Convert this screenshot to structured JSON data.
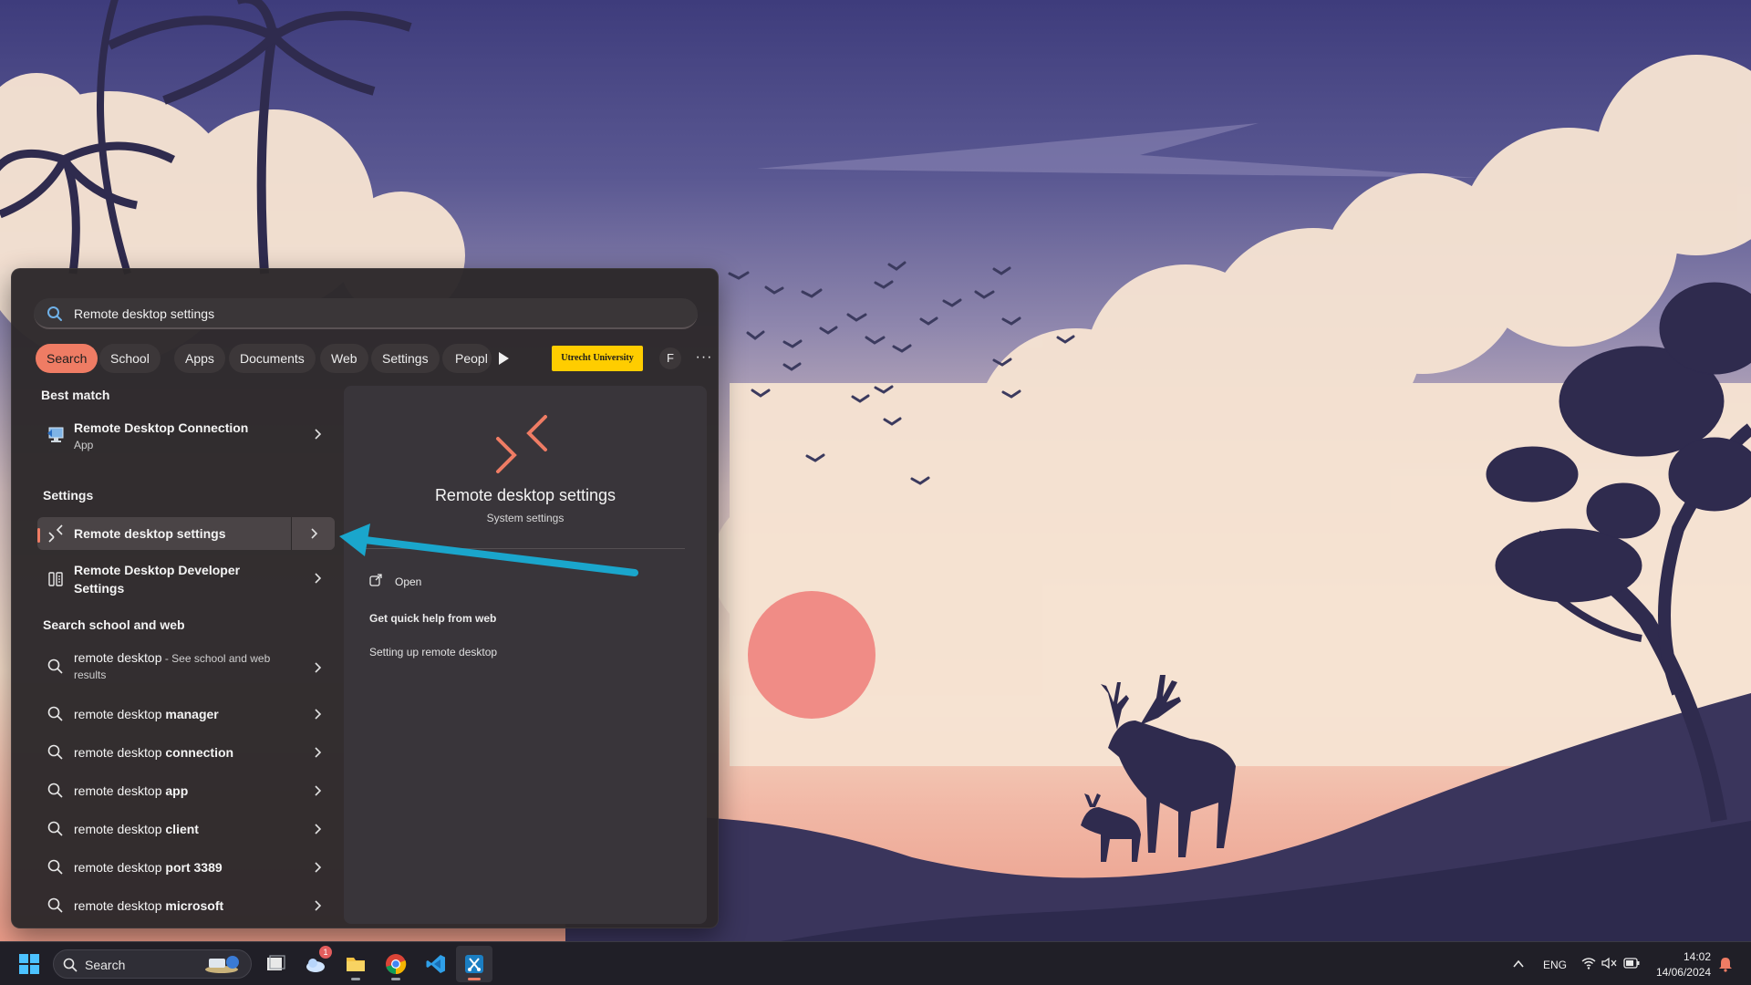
{
  "search": {
    "query": "Remote desktop settings"
  },
  "chips": [
    {
      "label": "Search",
      "active": true
    },
    {
      "label": "School"
    },
    {
      "label": "Apps"
    },
    {
      "label": "Documents"
    },
    {
      "label": "Web"
    },
    {
      "label": "Settings"
    },
    {
      "label": "Peopl"
    }
  ],
  "chips_extra": {
    "org_logo": "Utrecht University",
    "avatar": "F",
    "more": "···"
  },
  "best_match": {
    "heading": "Best match",
    "item": {
      "title": "Remote Desktop Connection",
      "subtitle": "App",
      "icon": "remote-desktop-connection-icon"
    }
  },
  "settings_section": {
    "heading": "Settings",
    "items": [
      {
        "title": "Remote desktop settings",
        "icon": "remote-desktop-icon",
        "selected": true
      },
      {
        "title_line1": "Remote Desktop Developer",
        "title_line2": "Settings",
        "icon": "developer-settings-icon"
      }
    ]
  },
  "web_section": {
    "heading": "Search school and web",
    "first": {
      "prefix": "remote desktop",
      "suffix": " - See school and web",
      "suffix2": "results"
    },
    "items": [
      {
        "prefix": "remote desktop ",
        "bold": "manager"
      },
      {
        "prefix": "remote desktop ",
        "bold": "connection"
      },
      {
        "prefix": "remote desktop ",
        "bold": "app"
      },
      {
        "prefix": "remote desktop ",
        "bold": "client"
      },
      {
        "prefix": "remote desktop ",
        "bold": "port 3389"
      },
      {
        "prefix": "remote desktop ",
        "bold": "microsoft"
      }
    ]
  },
  "preview": {
    "title": "Remote desktop settings",
    "subtitle": "System settings",
    "open": "Open",
    "help_heading": "Get quick help from web",
    "links": [
      "Setting up remote desktop"
    ]
  },
  "taskbar": {
    "search_label": "Search",
    "notification_badge": "1",
    "tray": {
      "language": "ENG",
      "time": "14:02",
      "date": "14/06/2024"
    }
  },
  "colors": {
    "accent": "#ef7c64",
    "annotation_arrow": "#1aa6cc",
    "org_logo": "#ffcd00"
  }
}
